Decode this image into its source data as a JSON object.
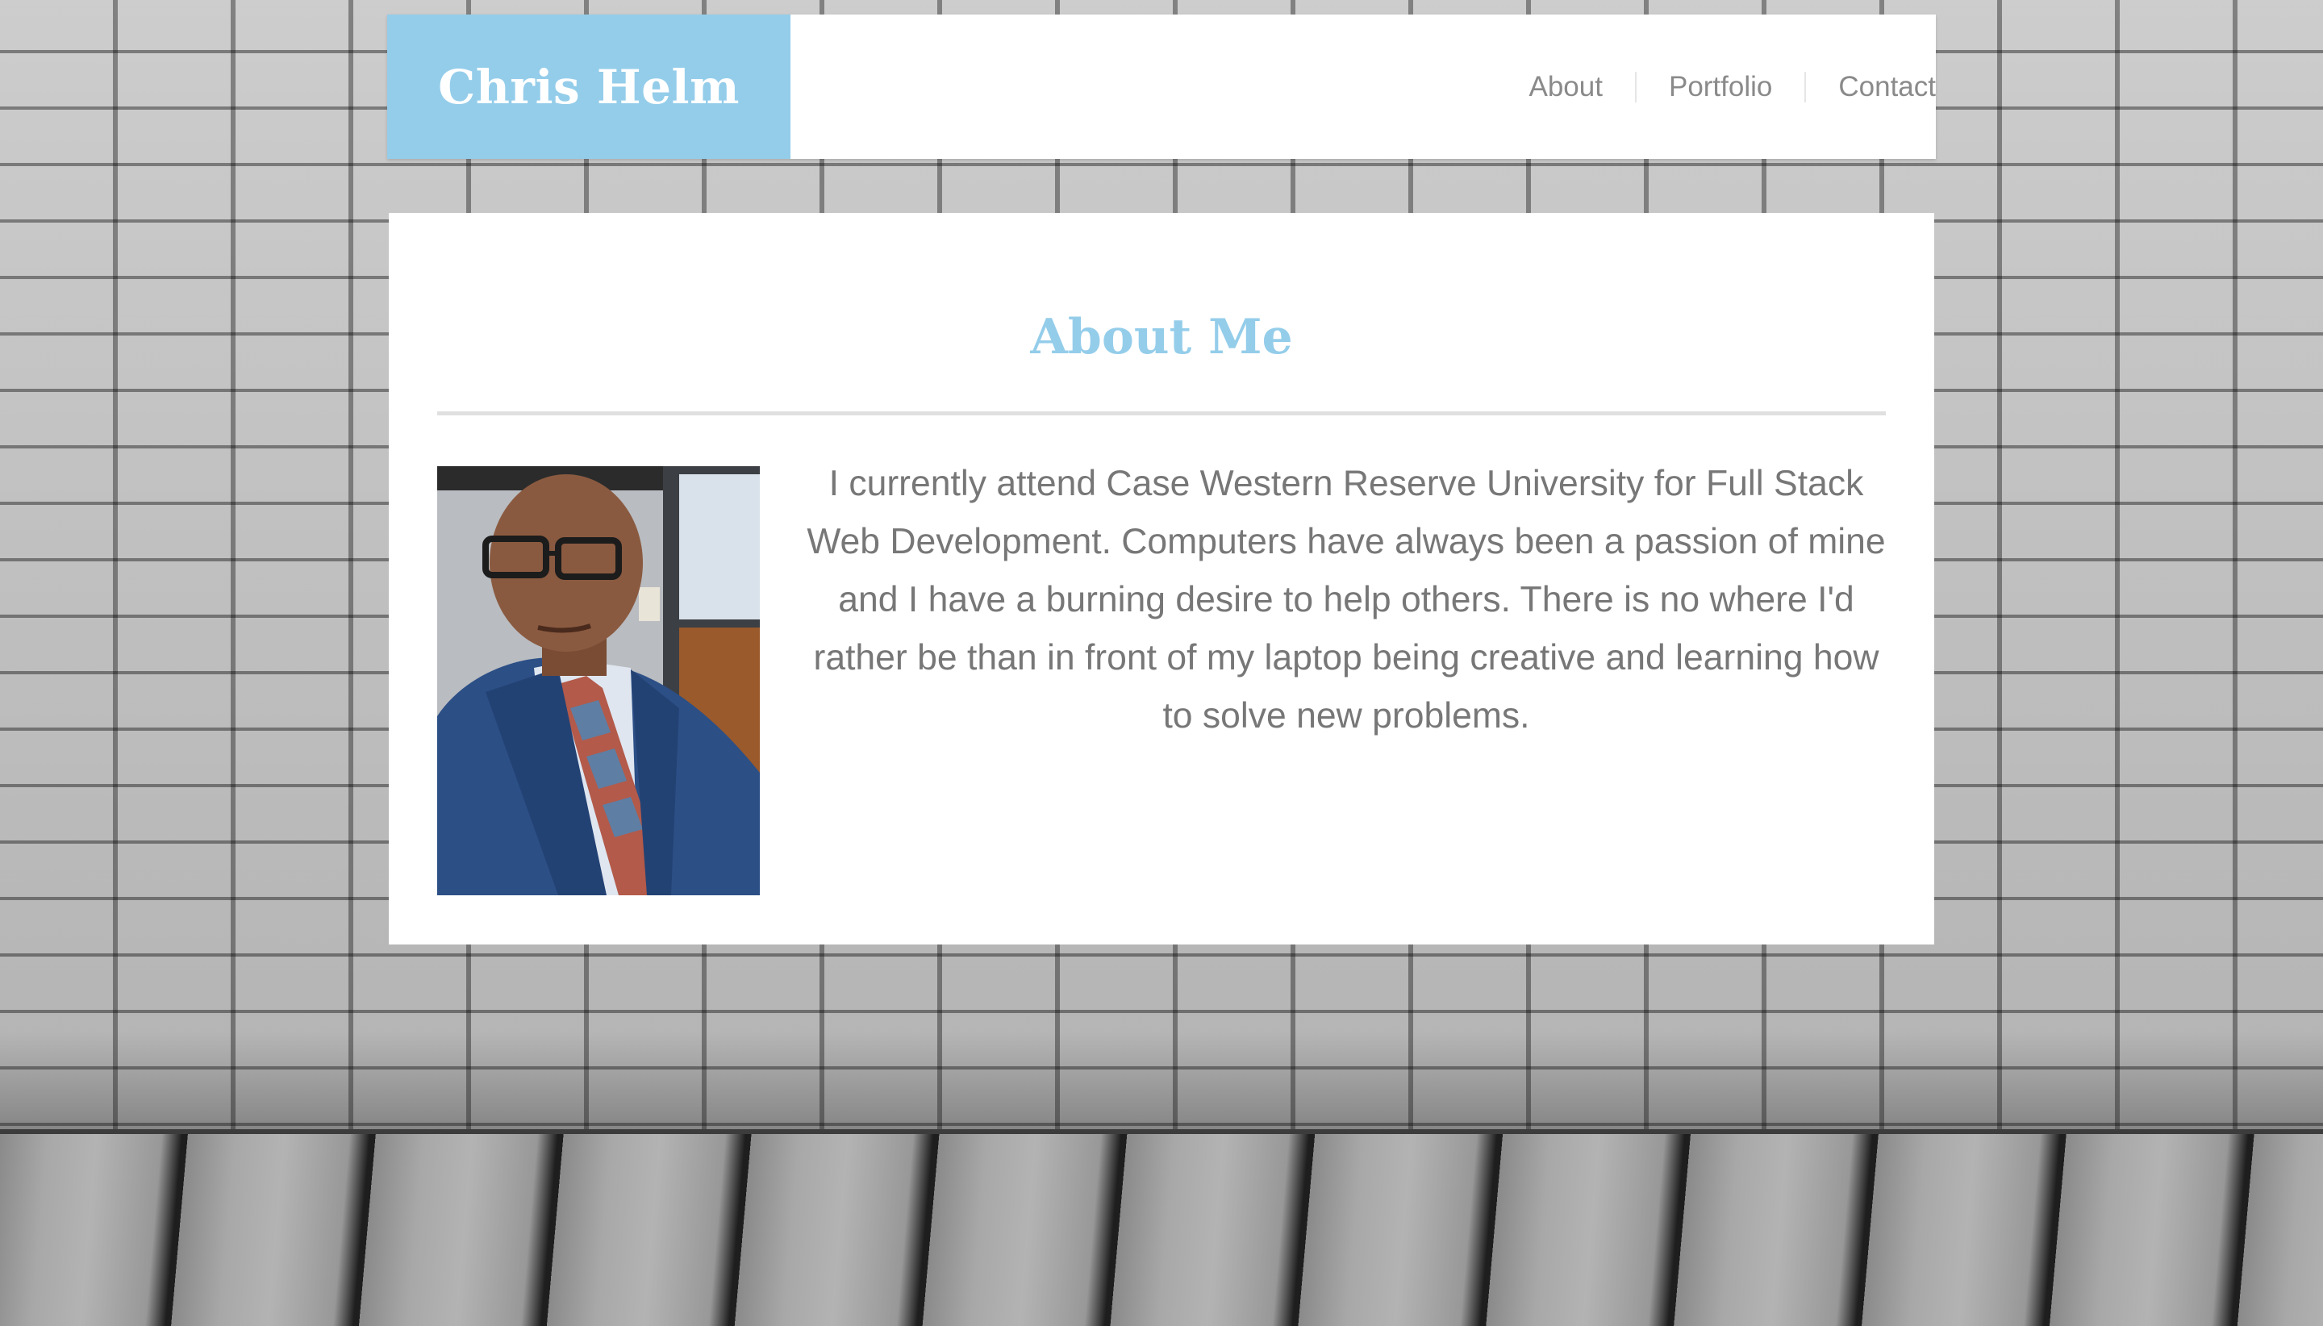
{
  "header": {
    "brand": "Chris Helm",
    "nav": [
      {
        "label": "About"
      },
      {
        "label": "Portfolio"
      },
      {
        "label": "Contact"
      }
    ]
  },
  "about": {
    "title": "About Me",
    "bio": "I currently attend Case Western Reserve University for Full Stack Web Development. Computers have always been a passion of mine and I have a burning desire to help others. There is no where I'd rather be than in front of my laptop being creative and learning how to solve new problems.",
    "photo_alt": "profile photo"
  },
  "colors": {
    "accent": "#94cdea",
    "nav_text": "#8a8a8a",
    "body_text": "#777777",
    "card_bg": "#ffffff"
  }
}
